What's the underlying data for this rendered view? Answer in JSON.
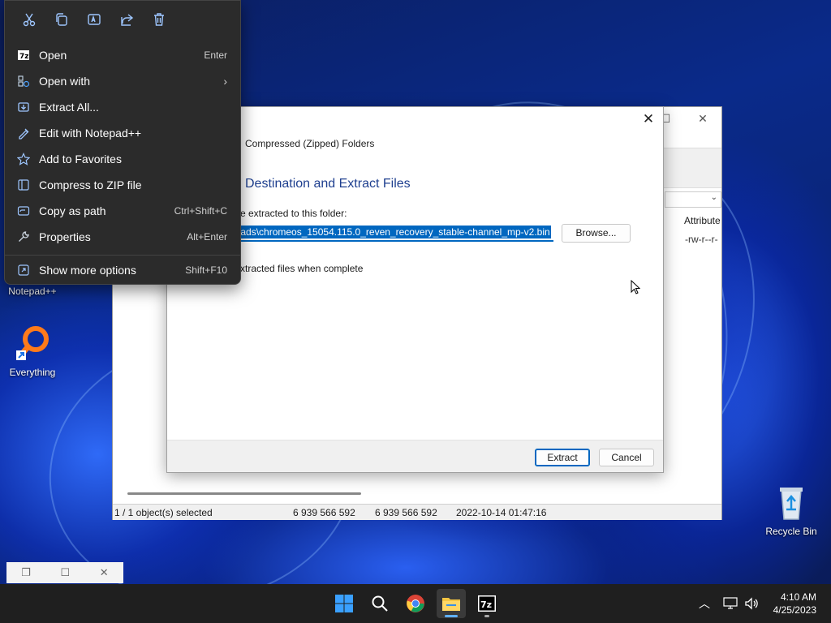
{
  "context_menu": {
    "quick_actions": [
      "cut-icon",
      "copy-icon",
      "rename-icon",
      "share-icon",
      "delete-icon"
    ],
    "items": [
      {
        "label": "Open",
        "shortcut": "Enter",
        "icon": "7zip-icon"
      },
      {
        "label": "Open with",
        "shortcut": "",
        "icon": "open-with-icon",
        "submenu": true
      },
      {
        "label": "Extract All...",
        "shortcut": "",
        "icon": "extract-icon"
      },
      {
        "label": "Edit with Notepad++",
        "shortcut": "",
        "icon": "notepad-icon"
      },
      {
        "label": "Add to Favorites",
        "shortcut": "",
        "icon": "star-icon"
      },
      {
        "label": "Compress to ZIP file",
        "shortcut": "",
        "icon": "zip-icon"
      },
      {
        "label": "Copy as path",
        "shortcut": "Ctrl+Shift+C",
        "icon": "copy-path-icon"
      },
      {
        "label": "Properties",
        "shortcut": "Alt+Enter",
        "icon": "wrench-icon"
      },
      {
        "label": "Show more options",
        "shortcut": "Shift+F10",
        "icon": "more-options-icon"
      }
    ]
  },
  "extract_dialog": {
    "subtitle": "Compressed (Zipped) Folders",
    "heading": "Destination and Extract Files",
    "folder_label": "e extracted to this folder:",
    "path_value": "loads\\chromeos_15054.115.0_reven_recovery_stable-channel_mp-v2.bin",
    "browse_label": "Browse...",
    "show_files_label": "xtracted files when complete",
    "extract_label": "Extract",
    "cancel_label": "Cancel"
  },
  "zip_window": {
    "attributes_header": "Attribute",
    "attributes_value": "-rw-r--r-",
    "status": {
      "selection": "1 / 1 object(s) selected",
      "size": "6 939 566 592",
      "packed": "6 939 566 592",
      "modified": "2022-10-14 01:47:16"
    }
  },
  "desktop_icons": {
    "notepad": "Notepad++",
    "everything": "Everything",
    "recycle": "Recycle Bin"
  },
  "taskbar": {
    "time": "4:10 AM",
    "date": "4/25/2023"
  },
  "colors": {
    "accent": "#0067c0",
    "heading": "#1e3f8f",
    "menu_bg": "#2b2b2b"
  }
}
